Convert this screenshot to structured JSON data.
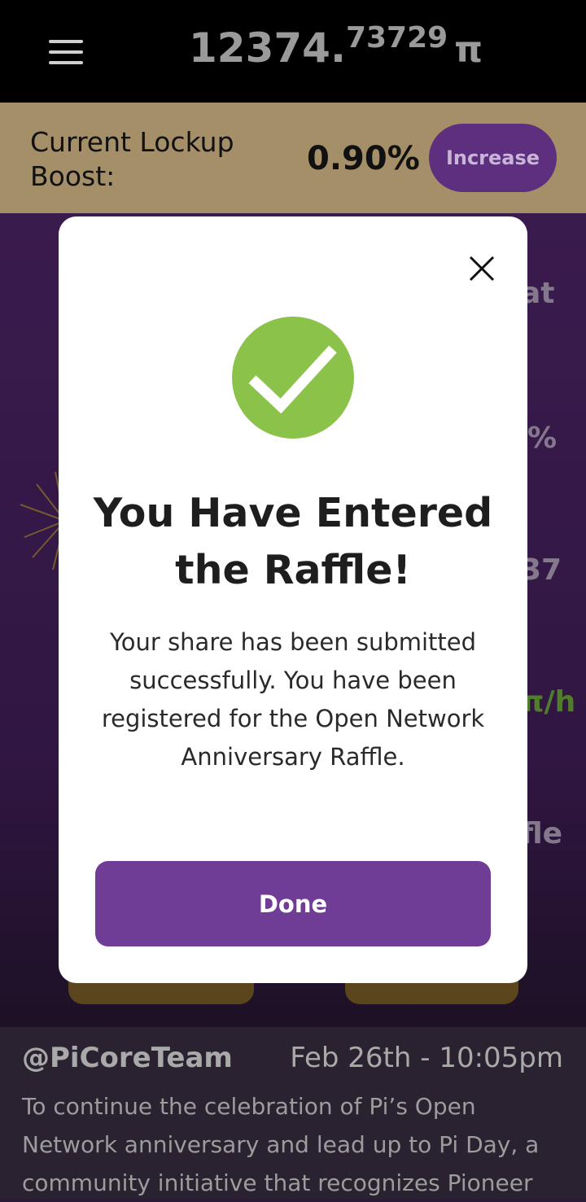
{
  "header": {
    "balance_integer": "12374.",
    "balance_decimal": "73729",
    "currency_symbol": "π"
  },
  "lockup": {
    "label": "Current Lockup Boost:",
    "value": "0.90%",
    "button_label": "Increase"
  },
  "background_fragments": {
    "f1": "at",
    "f2": "%",
    "f3": "37",
    "f4": "π/h",
    "f5": "fle"
  },
  "modal": {
    "title": "You Have Entered the Raffle!",
    "body": "Your share has been submitted successfully. You have been registered for the Open Network Anniversary Raffle.",
    "done_label": "Done"
  },
  "news": {
    "handle": "@PiCoreTeam",
    "date": "Feb 26th - 10:05pm",
    "body": "To continue the celebration of Pi’s Open Network anniversary and lead up to Pi Day, a community initiative that recognizes Pioneer"
  },
  "colors": {
    "topbar": "#000000",
    "lockup_bar": "#a48f68",
    "accent_purple": "#6f3d96",
    "success_green": "#8bc34a"
  },
  "icons": [
    "menu-icon",
    "close-icon",
    "checkmark-icon"
  ]
}
